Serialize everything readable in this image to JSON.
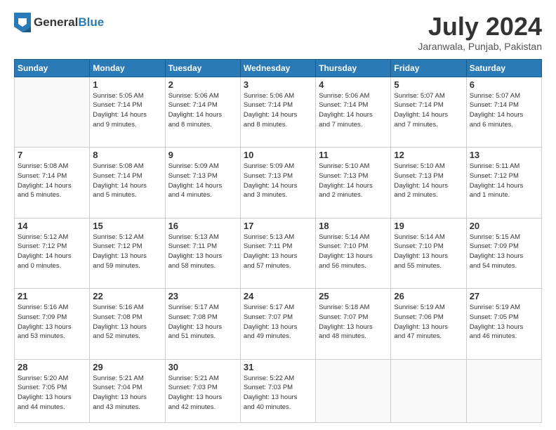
{
  "logo": {
    "general": "General",
    "blue": "Blue"
  },
  "title": "July 2024",
  "location": "Jaranwala, Punjab, Pakistan",
  "days": [
    "Sunday",
    "Monday",
    "Tuesday",
    "Wednesday",
    "Thursday",
    "Friday",
    "Saturday"
  ],
  "weeks": [
    [
      {
        "date": "",
        "info": ""
      },
      {
        "date": "1",
        "info": "Sunrise: 5:05 AM\nSunset: 7:14 PM\nDaylight: 14 hours\nand 9 minutes."
      },
      {
        "date": "2",
        "info": "Sunrise: 5:06 AM\nSunset: 7:14 PM\nDaylight: 14 hours\nand 8 minutes."
      },
      {
        "date": "3",
        "info": "Sunrise: 5:06 AM\nSunset: 7:14 PM\nDaylight: 14 hours\nand 8 minutes."
      },
      {
        "date": "4",
        "info": "Sunrise: 5:06 AM\nSunset: 7:14 PM\nDaylight: 14 hours\nand 7 minutes."
      },
      {
        "date": "5",
        "info": "Sunrise: 5:07 AM\nSunset: 7:14 PM\nDaylight: 14 hours\nand 7 minutes."
      },
      {
        "date": "6",
        "info": "Sunrise: 5:07 AM\nSunset: 7:14 PM\nDaylight: 14 hours\nand 6 minutes."
      }
    ],
    [
      {
        "date": "7",
        "info": "Sunrise: 5:08 AM\nSunset: 7:14 PM\nDaylight: 14 hours\nand 5 minutes."
      },
      {
        "date": "8",
        "info": "Sunrise: 5:08 AM\nSunset: 7:14 PM\nDaylight: 14 hours\nand 5 minutes."
      },
      {
        "date": "9",
        "info": "Sunrise: 5:09 AM\nSunset: 7:13 PM\nDaylight: 14 hours\nand 4 minutes."
      },
      {
        "date": "10",
        "info": "Sunrise: 5:09 AM\nSunset: 7:13 PM\nDaylight: 14 hours\nand 3 minutes."
      },
      {
        "date": "11",
        "info": "Sunrise: 5:10 AM\nSunset: 7:13 PM\nDaylight: 14 hours\nand 2 minutes."
      },
      {
        "date": "12",
        "info": "Sunrise: 5:10 AM\nSunset: 7:13 PM\nDaylight: 14 hours\nand 2 minutes."
      },
      {
        "date": "13",
        "info": "Sunrise: 5:11 AM\nSunset: 7:12 PM\nDaylight: 14 hours\nand 1 minute."
      }
    ],
    [
      {
        "date": "14",
        "info": "Sunrise: 5:12 AM\nSunset: 7:12 PM\nDaylight: 14 hours\nand 0 minutes."
      },
      {
        "date": "15",
        "info": "Sunrise: 5:12 AM\nSunset: 7:12 PM\nDaylight: 13 hours\nand 59 minutes."
      },
      {
        "date": "16",
        "info": "Sunrise: 5:13 AM\nSunset: 7:11 PM\nDaylight: 13 hours\nand 58 minutes."
      },
      {
        "date": "17",
        "info": "Sunrise: 5:13 AM\nSunset: 7:11 PM\nDaylight: 13 hours\nand 57 minutes."
      },
      {
        "date": "18",
        "info": "Sunrise: 5:14 AM\nSunset: 7:10 PM\nDaylight: 13 hours\nand 56 minutes."
      },
      {
        "date": "19",
        "info": "Sunrise: 5:14 AM\nSunset: 7:10 PM\nDaylight: 13 hours\nand 55 minutes."
      },
      {
        "date": "20",
        "info": "Sunrise: 5:15 AM\nSunset: 7:09 PM\nDaylight: 13 hours\nand 54 minutes."
      }
    ],
    [
      {
        "date": "21",
        "info": "Sunrise: 5:16 AM\nSunset: 7:09 PM\nDaylight: 13 hours\nand 53 minutes."
      },
      {
        "date": "22",
        "info": "Sunrise: 5:16 AM\nSunset: 7:08 PM\nDaylight: 13 hours\nand 52 minutes."
      },
      {
        "date": "23",
        "info": "Sunrise: 5:17 AM\nSunset: 7:08 PM\nDaylight: 13 hours\nand 51 minutes."
      },
      {
        "date": "24",
        "info": "Sunrise: 5:17 AM\nSunset: 7:07 PM\nDaylight: 13 hours\nand 49 minutes."
      },
      {
        "date": "25",
        "info": "Sunrise: 5:18 AM\nSunset: 7:07 PM\nDaylight: 13 hours\nand 48 minutes."
      },
      {
        "date": "26",
        "info": "Sunrise: 5:19 AM\nSunset: 7:06 PM\nDaylight: 13 hours\nand 47 minutes."
      },
      {
        "date": "27",
        "info": "Sunrise: 5:19 AM\nSunset: 7:05 PM\nDaylight: 13 hours\nand 46 minutes."
      }
    ],
    [
      {
        "date": "28",
        "info": "Sunrise: 5:20 AM\nSunset: 7:05 PM\nDaylight: 13 hours\nand 44 minutes."
      },
      {
        "date": "29",
        "info": "Sunrise: 5:21 AM\nSunset: 7:04 PM\nDaylight: 13 hours\nand 43 minutes."
      },
      {
        "date": "30",
        "info": "Sunrise: 5:21 AM\nSunset: 7:03 PM\nDaylight: 13 hours\nand 42 minutes."
      },
      {
        "date": "31",
        "info": "Sunrise: 5:22 AM\nSunset: 7:03 PM\nDaylight: 13 hours\nand 40 minutes."
      },
      {
        "date": "",
        "info": ""
      },
      {
        "date": "",
        "info": ""
      },
      {
        "date": "",
        "info": ""
      }
    ]
  ]
}
